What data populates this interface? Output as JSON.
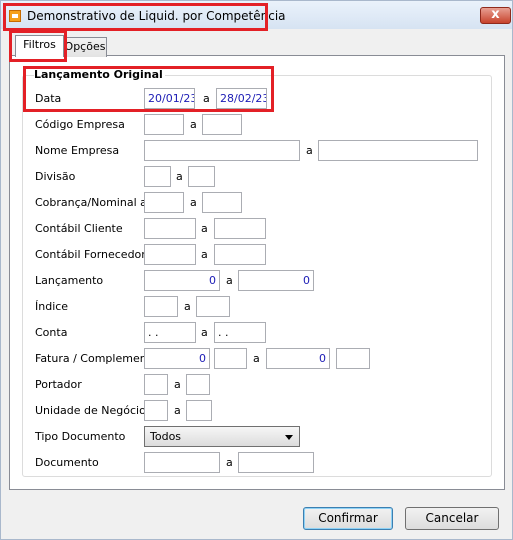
{
  "window": {
    "title": "Demonstrativo de  Liquid. por Competência",
    "close_glyph": "x"
  },
  "tabs": [
    {
      "label": "Filtros",
      "active": true
    },
    {
      "label": "Opções",
      "active": false
    }
  ],
  "group": {
    "title": "Lançamento Original"
  },
  "separator": "a",
  "fields": {
    "data": {
      "label": "Data",
      "from": "20/01/23",
      "to": "28/02/23"
    },
    "codigo_empresa": {
      "label": "Código Empresa",
      "from": "",
      "to": ""
    },
    "nome_empresa": {
      "label": "Nome Empresa",
      "from": "",
      "to": ""
    },
    "divisao": {
      "label": "Divisão",
      "from": "",
      "to": ""
    },
    "cobranca_nominal": {
      "label": "Cobrança/Nominal a",
      "from": "",
      "to": ""
    },
    "contabil_cliente": {
      "label": "Contábil Cliente",
      "from": "",
      "to": ""
    },
    "contabil_fornecedor": {
      "label": "Contábil Fornecedor",
      "from": "",
      "to": ""
    },
    "lancamento": {
      "label": "Lançamento",
      "from": "0",
      "to": "0"
    },
    "indice": {
      "label": "Índice",
      "from": "",
      "to": ""
    },
    "conta": {
      "label": "Conta",
      "from": " .  .",
      "to": " .  ."
    },
    "fatura": {
      "label": "Fatura / Complemento",
      "from": "0",
      "from_compl": "",
      "to": "0",
      "to_compl": ""
    },
    "portador": {
      "label": "Portador",
      "from": "",
      "to": ""
    },
    "unidade_negocio": {
      "label": "Unidade de Negócio",
      "from": "",
      "to": ""
    },
    "tipo_documento": {
      "label": "Tipo Documento",
      "selected": "Todos"
    },
    "documento": {
      "label": "Documento",
      "from": "",
      "to": ""
    }
  },
  "buttons": {
    "confirmar": "Confirmar",
    "cancelar": "Cancelar"
  },
  "colors": {
    "highlight_box": "#e32026",
    "input_text": "#1c1cb5"
  }
}
